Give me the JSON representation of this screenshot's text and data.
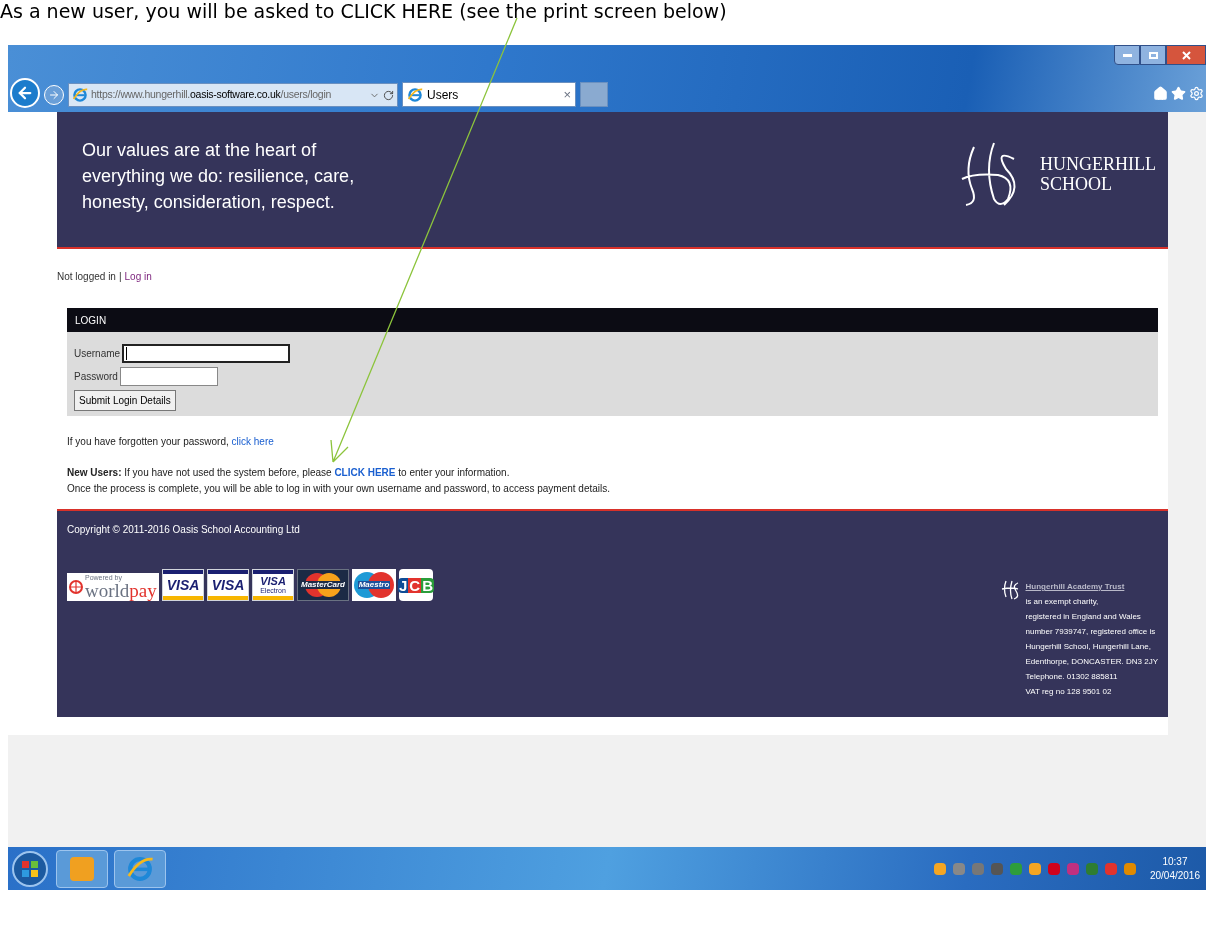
{
  "caption": "As a new user, you will be asked to CLICK HERE (see the print screen below)",
  "browser": {
    "address": "https://www.hungerhill.**oasis-software.co.uk**/users/login",
    "tab": {
      "title": "Users",
      "close": "×"
    }
  },
  "header": {
    "tagline": [
      "Our values are at the heart of",
      "everything we do: resilience, care,",
      "honesty, consideration, respect."
    ],
    "logo": [
      "HUNGERHILL",
      "SCHOOL"
    ]
  },
  "status": {
    "text": "Not logged in",
    "separator": "|",
    "link": "Log in"
  },
  "login": {
    "title": "LOGIN",
    "fields": [
      {
        "label": "Username",
        "focused": true
      },
      {
        "label": "Password",
        "focused": false
      }
    ],
    "submit": "Submit Login Details"
  },
  "forgot": {
    "text": "If you have forgotten your password,",
    "link": "click here"
  },
  "new_users": {
    "label": "New Users:",
    "before": "If you have not used the system before, please",
    "link": "CLICK HERE",
    "after": "to enter your information.",
    "line2": "Once the process is complete, you will be able to log in with your own username and password, to access payment details."
  },
  "footer": {
    "copyright": "Copyright © 2011-2016 Oasis School Accounting Ltd",
    "payment_logos": [
      {
        "kind": "worldpay",
        "small": "Powered by",
        "text": "world",
        "accent": "pay"
      },
      {
        "kind": "visa",
        "text": "VISA"
      },
      {
        "kind": "visa",
        "text": "VISA"
      },
      {
        "kind": "visa",
        "text": "VISA",
        "sub": "Electron"
      },
      {
        "kind": "mastercard",
        "text": "MasterCard"
      },
      {
        "kind": "maestro",
        "text": "Maestro"
      },
      {
        "kind": "jcb",
        "text": "JCB"
      }
    ],
    "trust": {
      "link": "Hungerhill Academy Trust",
      "lines": [
        "is an exempt charity,",
        "registered in England and Wales",
        "number 7939747, registered office is",
        "Hungerhill School, Hungerhill Lane,",
        "Edenthorpe, DONCASTER. DN3 2JY",
        "Telephone. 01302 885811",
        "VAT reg no 128 9501 02"
      ]
    }
  },
  "taskbar": {
    "time": "10:37",
    "date": "20/04/2016"
  }
}
